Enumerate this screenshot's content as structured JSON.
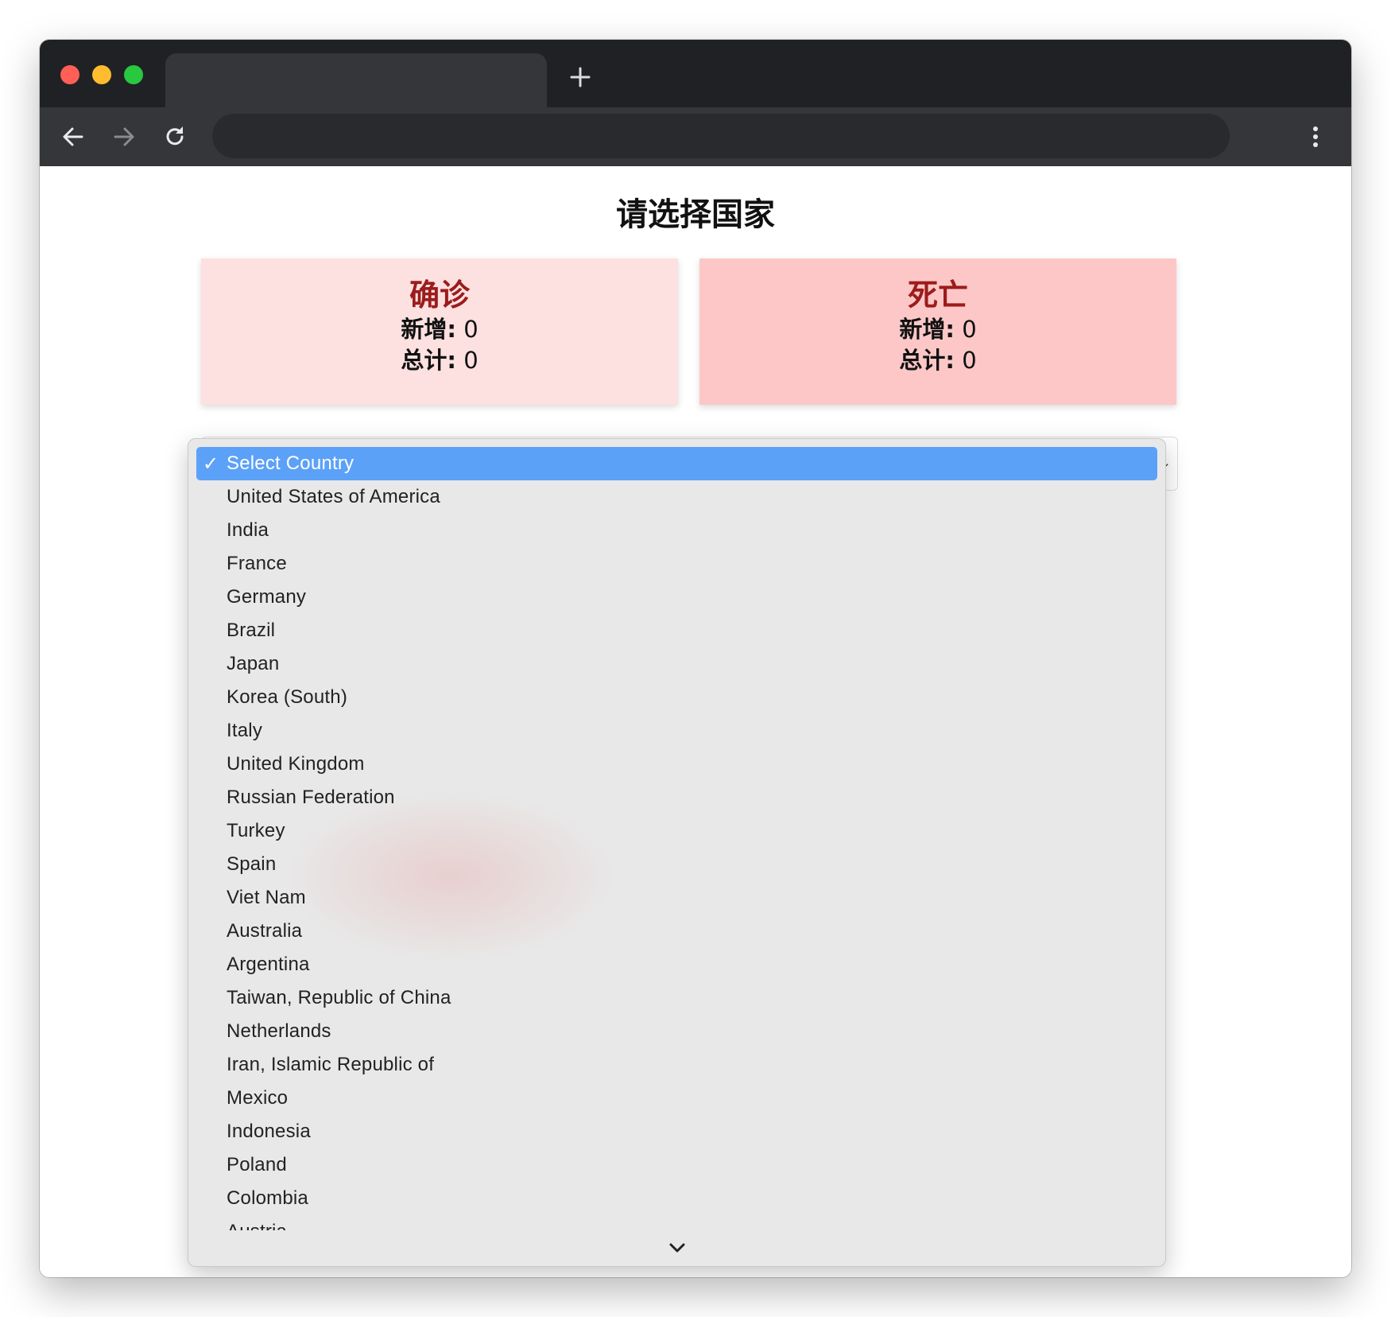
{
  "browser": {
    "tab_title": "",
    "address": "",
    "colors": {
      "titlebar": "#202124",
      "toolbar": "#35363a",
      "omnibox": "#282a2d"
    }
  },
  "icons": {
    "new_tab": "plus-icon",
    "back": "arrow-left-icon",
    "forward": "arrow-right-icon",
    "reload": "reload-icon",
    "menu": "vertical-dots-icon",
    "check": "checkmark-icon",
    "scroll_down": "chevron-down-icon"
  },
  "page": {
    "title": "请选择国家",
    "cards": {
      "confirmed": {
        "title": "确诊",
        "new_label": "新增:",
        "new_value": "0",
        "total_label": "总计:",
        "total_value": "0",
        "background": "#fde0e0"
      },
      "deaths": {
        "title": "死亡",
        "new_label": "新增:",
        "new_value": "0",
        "total_label": "总计:",
        "total_value": "0",
        "background": "#fdc7c7"
      }
    },
    "card_title_color": "#9b1c1c"
  },
  "country_select": {
    "selected": "Select Country",
    "highlight_color": "#5ca1f8",
    "options": [
      "Select Country",
      "United States of America",
      "India",
      "France",
      "Germany",
      "Brazil",
      "Japan",
      "Korea (South)",
      "Italy",
      "United Kingdom",
      "Russian Federation",
      "Turkey",
      "Spain",
      "Viet Nam",
      "Australia",
      "Argentina",
      "Taiwan, Republic of China",
      "Netherlands",
      "Iran, Islamic Republic of",
      "Mexico",
      "Indonesia",
      "Poland",
      "Colombia",
      "Austria"
    ]
  }
}
